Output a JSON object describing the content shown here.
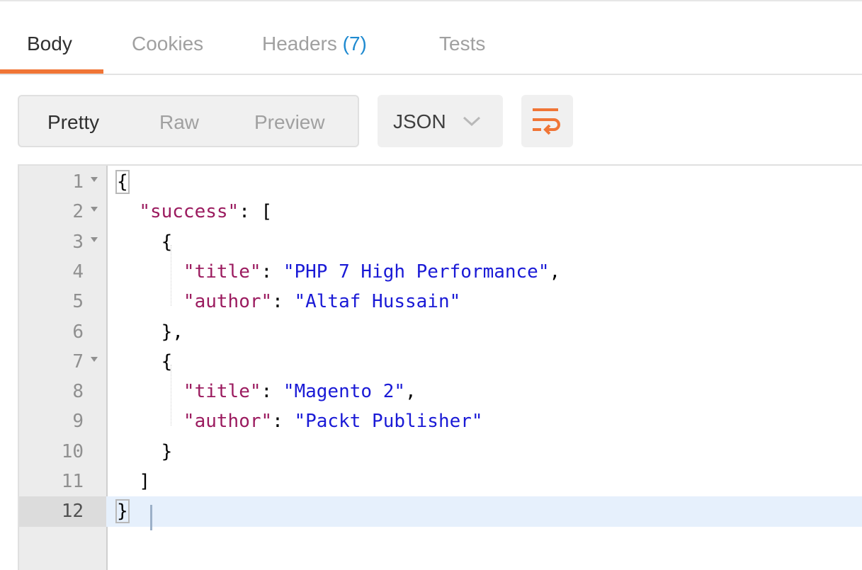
{
  "tabs": [
    {
      "label": "Body",
      "active": true
    },
    {
      "label": "Cookies",
      "active": false
    },
    {
      "label": "Headers",
      "count": "(7)",
      "active": false
    },
    {
      "label": "Tests",
      "active": false
    }
  ],
  "view_modes": [
    {
      "label": "Pretty",
      "active": true
    },
    {
      "label": "Raw",
      "active": false
    },
    {
      "label": "Preview",
      "active": false
    }
  ],
  "format": {
    "selected": "JSON",
    "icon": "chevron-down-icon"
  },
  "wrap_button": {
    "icon": "wrap-lines-icon"
  },
  "colors": {
    "accent": "#f07536",
    "key": "#9b1b5f",
    "string": "#1a1ad6",
    "count": "#1f8ad0",
    "active_line": "#e6f0fc"
  },
  "editor": {
    "active_line": 12,
    "lines": [
      {
        "num": "1",
        "fold": true
      },
      {
        "num": "2",
        "fold": true
      },
      {
        "num": "3",
        "fold": true
      },
      {
        "num": "4",
        "fold": false
      },
      {
        "num": "5",
        "fold": false
      },
      {
        "num": "6",
        "fold": false
      },
      {
        "num": "7",
        "fold": true
      },
      {
        "num": "8",
        "fold": false
      },
      {
        "num": "9",
        "fold": false
      },
      {
        "num": "10",
        "fold": false
      },
      {
        "num": "11",
        "fold": false
      },
      {
        "num": "12",
        "fold": false
      }
    ],
    "code": {
      "l1": "{",
      "l2_key": "\"success\"",
      "l2_rest": ": [",
      "l3": "{",
      "l4_key": "\"title\"",
      "l4_sep": ": ",
      "l4_val": "\"PHP 7 High Performance\"",
      "l4_end": ",",
      "l5_key": "\"author\"",
      "l5_sep": ": ",
      "l5_val": "\"Altaf Hussain\"",
      "l6": "},",
      "l7": "{",
      "l8_key": "\"title\"",
      "l8_sep": ": ",
      "l8_val": "\"Magento 2\"",
      "l8_end": ",",
      "l9_key": "\"author\"",
      "l9_sep": ": ",
      "l9_val": "\"Packt Publisher\"",
      "l10": "}",
      "l11": "]",
      "l12": "}"
    }
  }
}
